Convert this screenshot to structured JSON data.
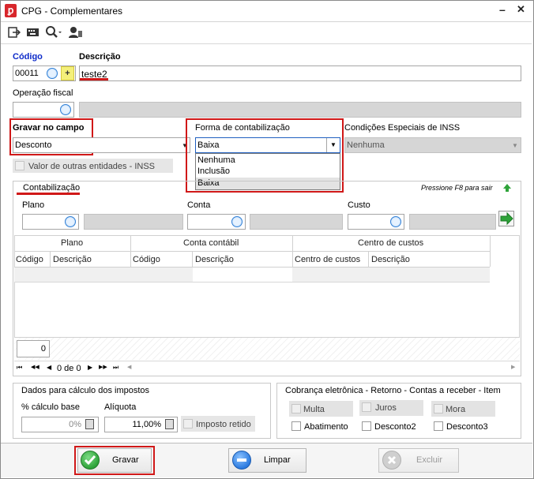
{
  "window": {
    "title": "CPG - Complementares",
    "minimize_glyph": "–",
    "close_glyph": "✕"
  },
  "toolbar": {
    "icons": [
      "exit-icon",
      "keyboard-icon",
      "search-icon",
      "user-icon"
    ]
  },
  "codigo": {
    "label": "Código",
    "value": "00011",
    "add_glyph": "+"
  },
  "descricao": {
    "label": "Descrição",
    "value": "teste2"
  },
  "operacao": {
    "label": "Operação fiscal",
    "value": ""
  },
  "gravar_campo": {
    "label": "Gravar no campo",
    "value": "Desconto"
  },
  "forma": {
    "label": "Forma de contabilização",
    "value": "Baixa",
    "options": [
      "Nenhuma",
      "Inclusão",
      "Baixa"
    ]
  },
  "inss": {
    "label": "Condições Especiais de INSS",
    "value": "Nenhuma"
  },
  "valor_outras": {
    "label": "Valor de outras entidades - INSS"
  },
  "contab": {
    "title": "Contabilização",
    "hint": "Pressione F8 para sair",
    "plano_label": "Plano",
    "conta_label": "Conta",
    "custo_label": "Custo",
    "grid": {
      "group_plano": "Plano",
      "group_conta": "Conta contábil",
      "group_centro": "Centro de custos",
      "col_codigo1": "Código",
      "col_descricao1": "Descrição",
      "col_codigo2": "Código",
      "col_descricao2": "Descrição",
      "col_centro": "Centro de custos",
      "col_descricao3": "Descrição",
      "count": "0"
    },
    "nav": {
      "first": "⏮",
      "prev_page": "◀◀",
      "prev": "◀",
      "record": "0 de 0",
      "next": "▶",
      "next_page": "▶▶",
      "last": "⏭"
    }
  },
  "impostos": {
    "title": "Dados para cálculo dos impostos",
    "base_label": "% cálculo base",
    "base_value": "0%",
    "aliquota_label": "Alíquota",
    "aliquota_value": "11,00%",
    "retido_label": "Imposto retido"
  },
  "cobranca": {
    "title": "Cobrança eletrônica - Retorno - Contas a receber - Item",
    "multa": "Multa",
    "juros": "Juros",
    "mora": "Mora",
    "abatimento": "Abatimento",
    "desconto2": "Desconto2",
    "desconto3": "Desconto3"
  },
  "buttons": {
    "gravar": "Gravar",
    "limpar": "Limpar",
    "excluir": "Excluir"
  },
  "colors": {
    "accent": "#0d2ac9",
    "highlight": "#d01818",
    "gravar": "#2fa33a",
    "limpar": "#2c7be0"
  }
}
